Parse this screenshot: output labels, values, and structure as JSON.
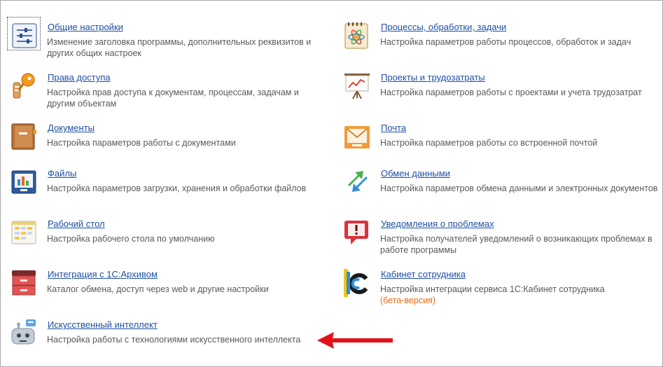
{
  "colors": {
    "link": "#1e4fa1",
    "desc": "#595959",
    "beta": "#e86a17",
    "arrow": "#e3101a"
  },
  "left": [
    {
      "icon": "settings-sliders-icon",
      "title": "Общие настройки",
      "desc": "Изменение заголовка программы, дополнительных реквизитов и других общих настроек"
    },
    {
      "icon": "key-icon",
      "title": "Права доступа",
      "desc": "Настройка прав доступа к документам, процессам, задачам и другим объектам"
    },
    {
      "icon": "folder-icon",
      "title": "Документы",
      "desc": "Настройка параметров работы с документами"
    },
    {
      "icon": "file-icon",
      "title": "Файлы",
      "desc": "Настройка параметров загрузки, хранения и обработки файлов"
    },
    {
      "icon": "desktop-icon",
      "title": "Рабочий стол",
      "desc": "Настройка рабочего стола по умолчанию"
    },
    {
      "icon": "archive-icon",
      "title": "Интеграция с 1С:Архивом",
      "desc": "Каталог обмена, доступ через web и другие настройки"
    },
    {
      "icon": "robot-icon",
      "title": "Искусственный интеллект",
      "desc": "Настройка работы с технологиями искусственного интеллекта"
    }
  ],
  "right": [
    {
      "icon": "process-icon",
      "title": "Процессы, обработки, задачи",
      "desc": "Настройка параметров работы процессов, обработок и задач"
    },
    {
      "icon": "projects-chart-icon",
      "title": "Проекты и трудозатраты",
      "desc": "Настройка параметров работы с проектами и учета трудозатрат"
    },
    {
      "icon": "mail-icon",
      "title": "Почта",
      "desc": "Настройка параметров работы со встроенной почтой"
    },
    {
      "icon": "exchange-arrows-icon",
      "title": "Обмен данными",
      "desc": "Настройка параметров обмена данными и электронных документов"
    },
    {
      "icon": "alert-icon",
      "title": "Уведомления о проблемах",
      "desc": "Настройка получателей уведомлений о возникающих проблемах в работе программы"
    },
    {
      "icon": "1c-cabinet-icon",
      "title": "Кабинет сотрудника",
      "desc": "Настройка интеграции сервиса 1С:Кабинет сотрудника",
      "beta": "(бета-версия)"
    }
  ]
}
